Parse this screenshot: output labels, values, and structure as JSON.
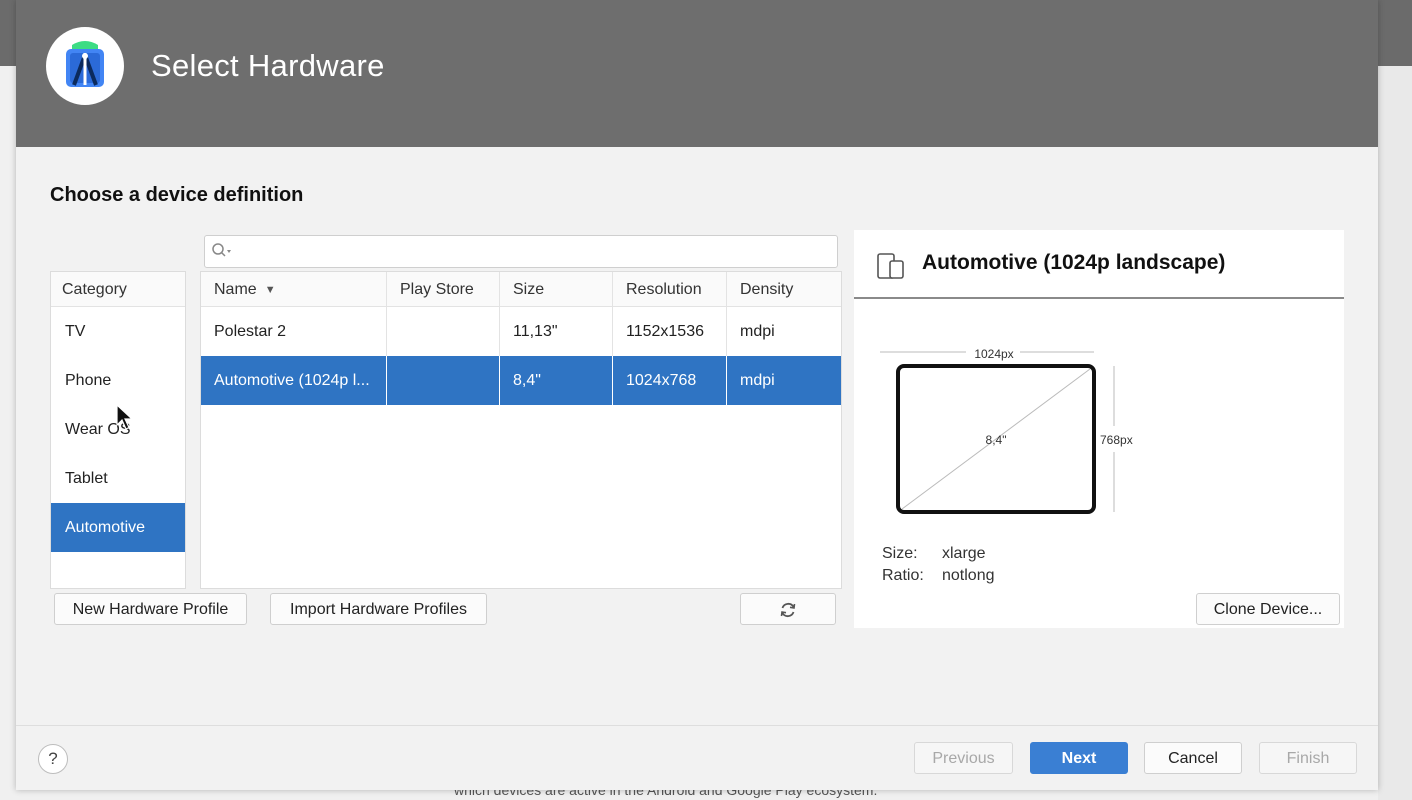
{
  "backdrop": {
    "bottom_text": "which devices are active in the Android and Google Play ecosystem."
  },
  "header": {
    "title": "Select Hardware",
    "logo_icon": "android-studio-logo-icon"
  },
  "section_title": "Choose a device definition",
  "search": {
    "value": "",
    "placeholder": "",
    "icon": "search-icon"
  },
  "category": {
    "header": "Category",
    "items": [
      {
        "label": "TV"
      },
      {
        "label": "Phone"
      },
      {
        "label": "Wear OS"
      },
      {
        "label": "Tablet"
      },
      {
        "label": "Automotive",
        "selected": true
      }
    ]
  },
  "table": {
    "columns": [
      "Name",
      "Play Store",
      "Size",
      "Resolution",
      "Density"
    ],
    "sort_column": "Name",
    "rows": [
      {
        "name": "Polestar 2",
        "play_store": "",
        "size": "11,13\"",
        "resolution": "1152x1536",
        "density": "mdpi"
      },
      {
        "name": "Automotive (1024p l...",
        "play_store": "",
        "size": "8,4\"",
        "resolution": "1024x768",
        "density": "mdpi",
        "selected": true
      }
    ]
  },
  "buttons": {
    "new_profile": "New Hardware Profile",
    "import_profiles": "Import Hardware Profiles",
    "refresh_icon": "refresh-icon",
    "clone_device": "Clone Device...",
    "previous": "Previous",
    "next": "Next",
    "cancel": "Cancel",
    "finish": "Finish",
    "help": "?"
  },
  "details": {
    "title": "Automotive (1024p landscape)",
    "icon": "device-icon",
    "width_label": "1024px",
    "height_label": "768px",
    "diagonal_label": "8,4\"",
    "size_label": "Size:",
    "size_value": "xlarge",
    "ratio_label": "Ratio:",
    "ratio_value": "notlong"
  },
  "colors": {
    "banner": "#6e6e6e",
    "selection": "#2f74c3",
    "primary_button": "#3a7fd3"
  }
}
